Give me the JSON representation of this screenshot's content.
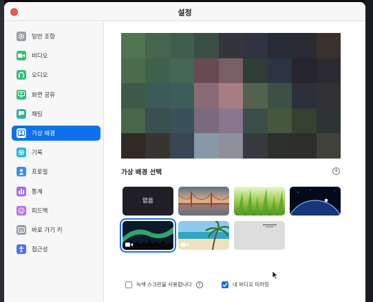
{
  "window": {
    "title": "설정"
  },
  "sidebar": {
    "items": [
      {
        "label": "일반 조항",
        "icon": "gear-icon",
        "color": "#9aa0a6"
      },
      {
        "label": "비디오",
        "icon": "video-camera-icon",
        "color": "#33c26b"
      },
      {
        "label": "오디오",
        "icon": "headphones-icon",
        "color": "#32c07a"
      },
      {
        "label": "화면 공유",
        "icon": "screen-share-icon",
        "color": "#2dbd76"
      },
      {
        "label": "채팅",
        "icon": "chat-bubble-icon",
        "color": "#2cb79b"
      },
      {
        "label": "가상 배경",
        "icon": "person-portrait-icon",
        "color": "#0e71eb",
        "active": true
      },
      {
        "label": "기록",
        "icon": "record-icon",
        "color": "#1fb6e8"
      },
      {
        "label": "프로필",
        "icon": "profile-icon",
        "color": "#3d8cf0"
      },
      {
        "label": "통계",
        "icon": "bar-chart-icon",
        "color": "#a26cf2"
      },
      {
        "label": "피드백",
        "icon": "smiley-icon",
        "color": "#b96ff0"
      },
      {
        "label": "바로 가기 키",
        "icon": "keyboard-icon",
        "color": "#8e98a8"
      },
      {
        "label": "접근성",
        "icon": "accessibility-icon",
        "color": "#4d6ff0"
      }
    ]
  },
  "main": {
    "section_title": "가상 배경 선택",
    "add_button": "+",
    "backgrounds": [
      {
        "name": "none",
        "label": "없음"
      },
      {
        "name": "golden-gate-bridge"
      },
      {
        "name": "grass"
      },
      {
        "name": "earth-from-space"
      },
      {
        "name": "aurora",
        "video": true,
        "selected": true
      },
      {
        "name": "beach",
        "video": true
      },
      {
        "name": "blank-light"
      }
    ],
    "green_screen_label": "녹색 스크린을 사용합니다",
    "green_screen_checked": false,
    "help_icon": "?",
    "mirror_label": "내 비디오 미러링",
    "mirror_checked": true
  },
  "colors": {
    "accent": "#0e71eb",
    "close": "#ee5a52"
  },
  "preview": {
    "mosaic_colors": [
      "#4f7552",
      "#46654f",
      "#3f5e4c",
      "#3b4e44",
      "#33363d",
      "#2f3342",
      "#272b35",
      "#2a2a32",
      "#3a302e",
      "#4a6c4a",
      "#3e614c",
      "#446655",
      "#6a4a52",
      "#7a5e66",
      "#2f3d35",
      "#2a3443",
      "#26242e",
      "#2a2a30",
      "#3f5a48",
      "#3c5a57",
      "#3d5d5a",
      "#8a6a77",
      "#a77d83",
      "#52624f",
      "#3d4f46",
      "#2c303a",
      "#323236",
      "#48664a",
      "#3a4f4f",
      "#3b515a",
      "#7a6b7c",
      "#87768c",
      "#3a4e49",
      "#45573d",
      "#344130",
      "#2e3334",
      "#2f2a26",
      "#383633",
      "#384656",
      "#8799a8",
      "#8e8f9b",
      "#363a3e",
      "#2c2f2c",
      "#2d2e2a",
      "#40423a"
    ]
  }
}
